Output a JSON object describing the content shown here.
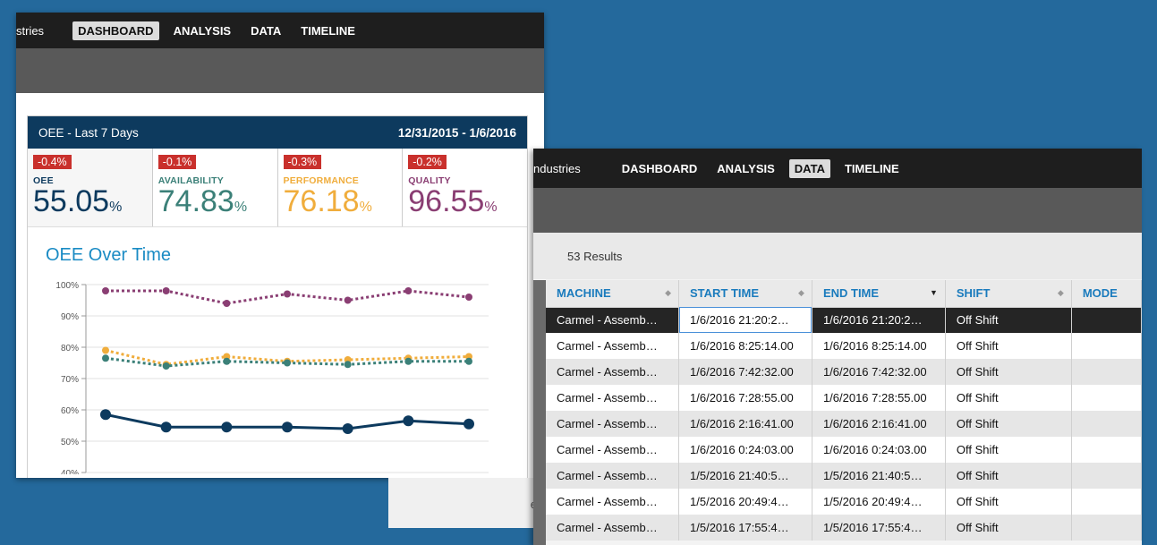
{
  "left_window": {
    "brand": "stries",
    "nav": [
      "DASHBOARD",
      "ANALYSIS",
      "DATA",
      "TIMELINE"
    ],
    "active_nav": "DASHBOARD",
    "panel": {
      "title": "OEE - Last 7 Days",
      "date_range": "12/31/2015 - 1/6/2016",
      "metrics": [
        {
          "delta": "-0.4%",
          "label": "OEE",
          "value": "55.05",
          "unit": "%",
          "color": "#0d3a5e"
        },
        {
          "delta": "-0.1%",
          "label": "AVAILABILITY",
          "value": "74.83",
          "unit": "%",
          "color": "#3b8078"
        },
        {
          "delta": "-0.3%",
          "label": "PERFORMANCE",
          "value": "76.18",
          "unit": "%",
          "color": "#f0ad3c"
        },
        {
          "delta": "-0.2%",
          "label": "QUALITY",
          "value": "96.55",
          "unit": "%",
          "color": "#8a3e73"
        }
      ]
    },
    "chart_title": "OEE Over Time",
    "bottom_fragment": "e"
  },
  "chart_data": {
    "type": "line",
    "title": "OEE Over Time",
    "ylim": [
      40,
      100
    ],
    "y_ticks": [
      "100%",
      "90%",
      "80%",
      "70%",
      "60%",
      "50%",
      "40%"
    ],
    "x": [
      1,
      2,
      3,
      4,
      5,
      6,
      7
    ],
    "series": [
      {
        "values": [
          98,
          98,
          94,
          97,
          95,
          98,
          96
        ],
        "color": "#8a3e73",
        "style": "dotted"
      },
      {
        "values": [
          79,
          74.5,
          77,
          75.5,
          76,
          76.5,
          77
        ],
        "color": "#f0ad3c",
        "style": "dotted"
      },
      {
        "values": [
          76.5,
          74,
          75.5,
          75,
          74.5,
          75.5,
          75.5
        ],
        "color": "#3b8078",
        "style": "dotted"
      },
      {
        "values": [
          58.5,
          54.5,
          54.5,
          54.5,
          54,
          56.5,
          55.5
        ],
        "color": "#0d3a5e",
        "style": "solid"
      }
    ],
    "grid": true
  },
  "right_window": {
    "brand": "ndustries",
    "nav": [
      "DASHBOARD",
      "ANALYSIS",
      "DATA",
      "TIMELINE"
    ],
    "active_nav": "DATA",
    "results": "53 Results",
    "columns": [
      "MACHINE",
      "START TIME",
      "END TIME",
      "SHIFT",
      "MODE"
    ],
    "rows": [
      [
        "Carmel - Assemb…",
        "1/6/2016 21:20:2…",
        "1/6/2016 21:20:2…",
        "Off Shift",
        ""
      ],
      [
        "Carmel - Assemb…",
        "1/6/2016 8:25:14.00",
        "1/6/2016 8:25:14.00",
        "Off Shift",
        ""
      ],
      [
        "Carmel - Assemb…",
        "1/6/2016 7:42:32.00",
        "1/6/2016 7:42:32.00",
        "Off Shift",
        ""
      ],
      [
        "Carmel - Assemb…",
        "1/6/2016 7:28:55.00",
        "1/6/2016 7:28:55.00",
        "Off Shift",
        ""
      ],
      [
        "Carmel - Assemb…",
        "1/6/2016 2:16:41.00",
        "1/6/2016 2:16:41.00",
        "Off Shift",
        ""
      ],
      [
        "Carmel - Assemb…",
        "1/6/2016 0:24:03.00",
        "1/6/2016 0:24:03.00",
        "Off Shift",
        ""
      ],
      [
        "Carmel - Assemb…",
        "1/5/2016 21:40:5…",
        "1/5/2016 21:40:5…",
        "Off Shift",
        ""
      ],
      [
        "Carmel - Assemb…",
        "1/5/2016 20:49:4…",
        "1/5/2016 20:49:4…",
        "Off Shift",
        ""
      ],
      [
        "Carmel - Assemb…",
        "1/5/2016 17:55:4…",
        "1/5/2016 17:55:4…",
        "Off Shift",
        ""
      ]
    ]
  }
}
